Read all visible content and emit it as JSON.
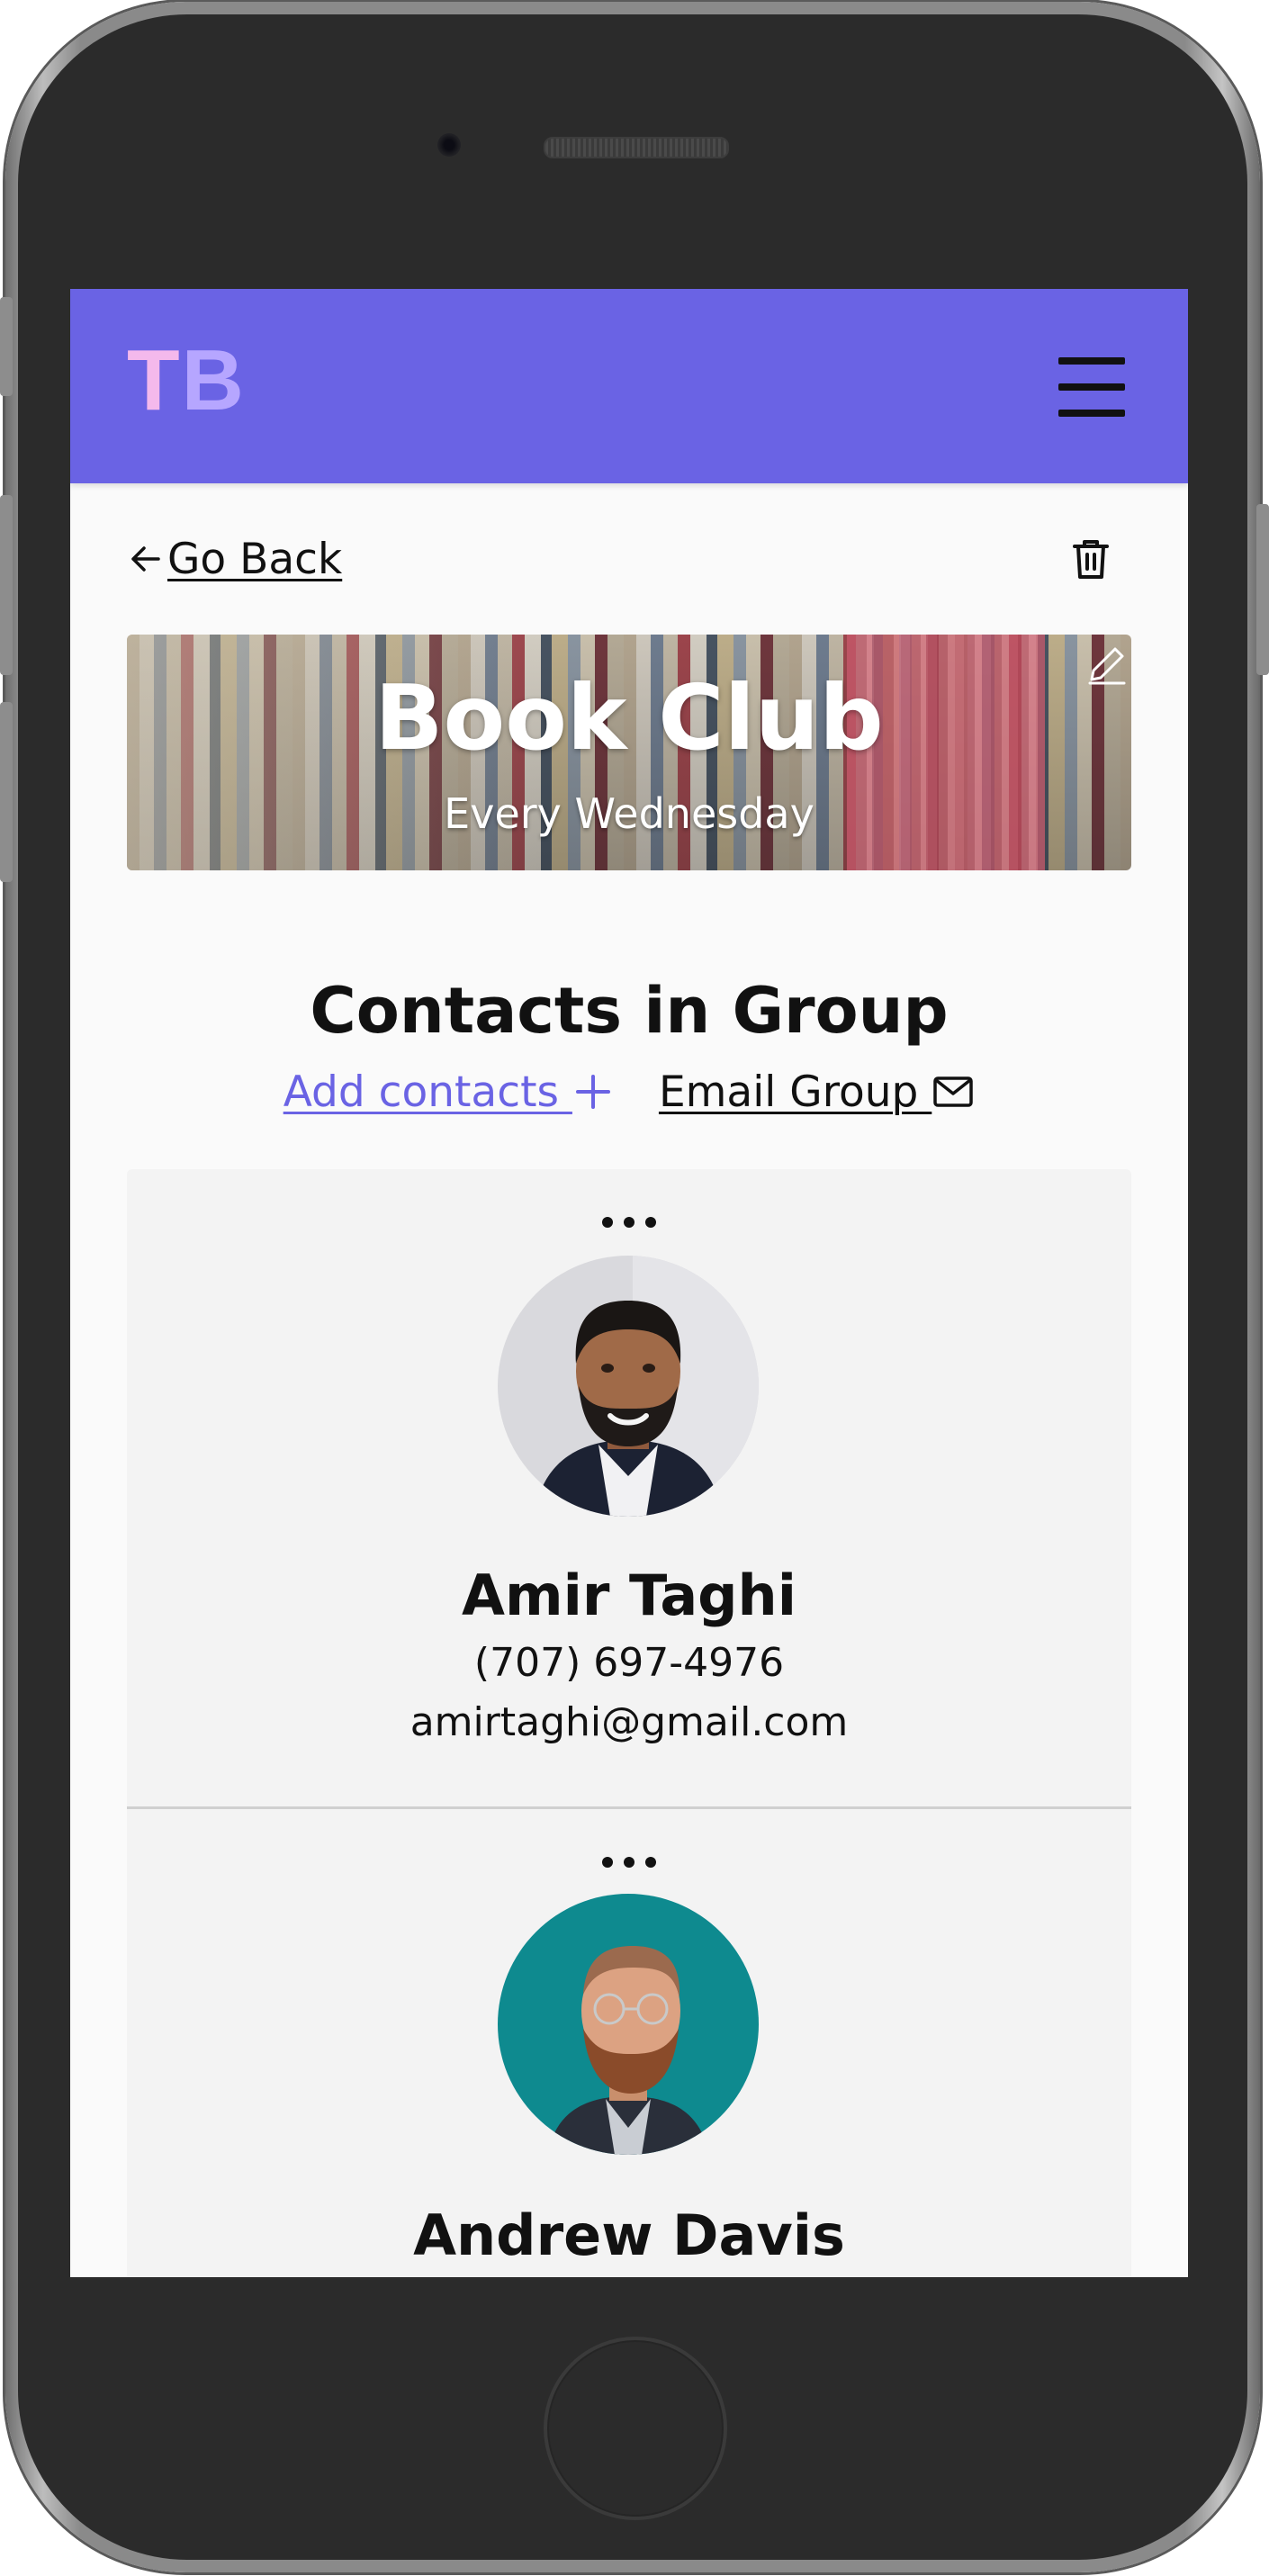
{
  "navbar": {
    "logo_letter_1": "T",
    "logo_letter_2": "B",
    "menu_icon": "hamburger-menu-icon",
    "background": "#6a63e4"
  },
  "toolbar": {
    "back_label": "Go Back",
    "back_icon": "arrow-left-icon",
    "delete_icon": "trash-icon"
  },
  "group": {
    "title": "Book Club",
    "subtitle": "Every Wednesday",
    "edit_icon": "pencil-icon"
  },
  "contacts_section": {
    "heading": "Contacts in Group",
    "add_label": "Add contacts ",
    "add_icon": "plus-icon",
    "email_label": "Email Group ",
    "email_icon": "envelope-icon",
    "accent": "#6a63e4"
  },
  "contacts": [
    {
      "name": "Amir Taghi",
      "phone": "(707) 697-4976",
      "email": "amirtaghi@gmail.com",
      "menu_icon": "more-dots-icon"
    },
    {
      "name": "Andrew Davis",
      "menu_icon": "more-dots-icon"
    }
  ]
}
